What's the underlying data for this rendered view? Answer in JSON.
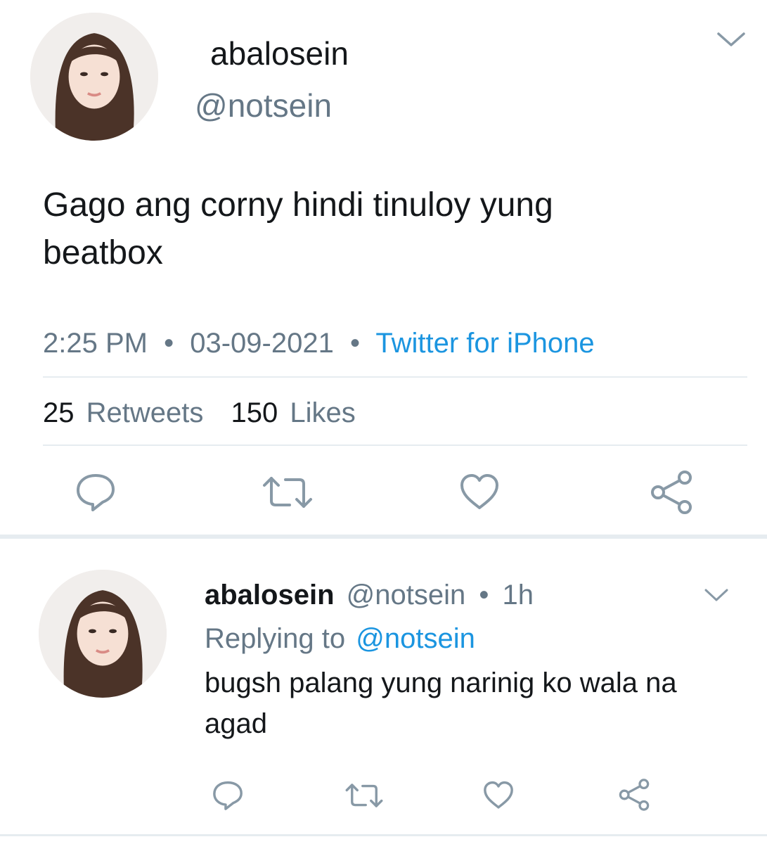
{
  "main_tweet": {
    "display_name": "abalosein",
    "handle": "@notsein",
    "text": "Gago ang corny hindi tinuloy yung beatbox",
    "time": "2:25 PM",
    "separator": "•",
    "date": "03-09-2021",
    "source": "Twitter for iPhone",
    "retweet_count": "25",
    "retweet_label": "Retweets",
    "like_count": "150",
    "like_label": "Likes"
  },
  "reply": {
    "display_name": "abalosein",
    "handle": "@notsein",
    "separator": "•",
    "time_ago": "1h",
    "replying_prefix": "Replying to",
    "replying_to": "@notsein",
    "text": "bugsh palang yung narinig ko wala na agad"
  },
  "icons": {
    "reply": "speech-bubble-icon",
    "retweet": "retweet-arrows-icon",
    "like": "heart-icon",
    "share": "share-icon",
    "more": "chevron-down-icon"
  },
  "colors": {
    "text": "#14171a",
    "secondary": "#657786",
    "link": "#1b95e0",
    "divider": "#e6ecf0"
  }
}
